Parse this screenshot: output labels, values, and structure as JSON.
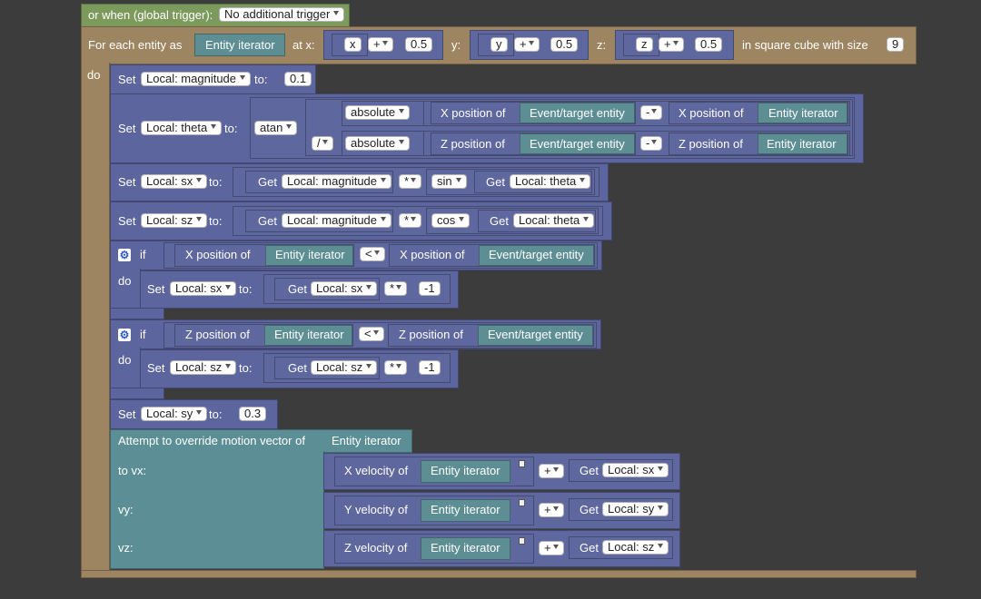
{
  "trigger": {
    "label": "or when (global trigger):",
    "value": "No additional trigger"
  },
  "foreach": {
    "prefix": "For each entity as",
    "iterator": "Entity iterator",
    "at_x": "at x:",
    "x_var": "x",
    "x_op": "+",
    "x_val": "0.5",
    "y_label": "y:",
    "y_var": "y",
    "y_op": "+",
    "y_val": "0.5",
    "z_label": "z:",
    "z_var": "z",
    "z_op": "+",
    "z_val": "0.5",
    "cube_label": "in square cube with size",
    "cube_size": "9",
    "do_label": "do"
  },
  "common": {
    "set": "Set",
    "to": "to:",
    "get": "Get",
    "if": "if",
    "do": "do",
    "x_pos": "X position of",
    "z_pos": "Z position of",
    "entity_iterator": "Entity iterator",
    "event_target": "Event/target entity",
    "multiply": "*",
    "minus": "-",
    "less": "<",
    "plus": "+",
    "divide": "/"
  },
  "set_magnitude": {
    "var": "Local: magnitude",
    "value": "0.1"
  },
  "set_theta": {
    "var": "Local: theta",
    "func": "atan",
    "abs1": "absolute",
    "abs2": "absolute"
  },
  "set_sx": {
    "var": "Local: sx",
    "get_var": "Local: magnitude",
    "func": "sin",
    "func_var": "Local: theta"
  },
  "set_sz": {
    "var": "Local: sz",
    "get_var": "Local: magnitude",
    "func": "cos",
    "func_var": "Local: theta"
  },
  "if1": {
    "set_var": "Local: sx",
    "get_var": "Local: sx",
    "value": "-1"
  },
  "if2": {
    "set_var": "Local: sz",
    "get_var": "Local: sz",
    "value": "-1"
  },
  "set_sy": {
    "var": "Local: sy",
    "value": "0.3"
  },
  "motion": {
    "title": "Attempt to override motion vector of",
    "entity": "Entity iterator",
    "rows": [
      {
        "label": "to vx:",
        "vel": "X velocity of",
        "entity": "Entity iterator",
        "var": "Local: sx"
      },
      {
        "label": "vy:",
        "vel": "Y velocity of",
        "entity": "Entity iterator",
        "var": "Local: sy"
      },
      {
        "label": "vz:",
        "vel": "Z velocity of",
        "entity": "Entity iterator",
        "var": "Local: sz"
      }
    ]
  },
  "colors": {
    "event": "#7b9a5c",
    "loop": "#9e8561",
    "set": "#5c659e",
    "motion": "#5b8f95",
    "entity": "#5c8e94",
    "background": "#3c3c3c"
  }
}
